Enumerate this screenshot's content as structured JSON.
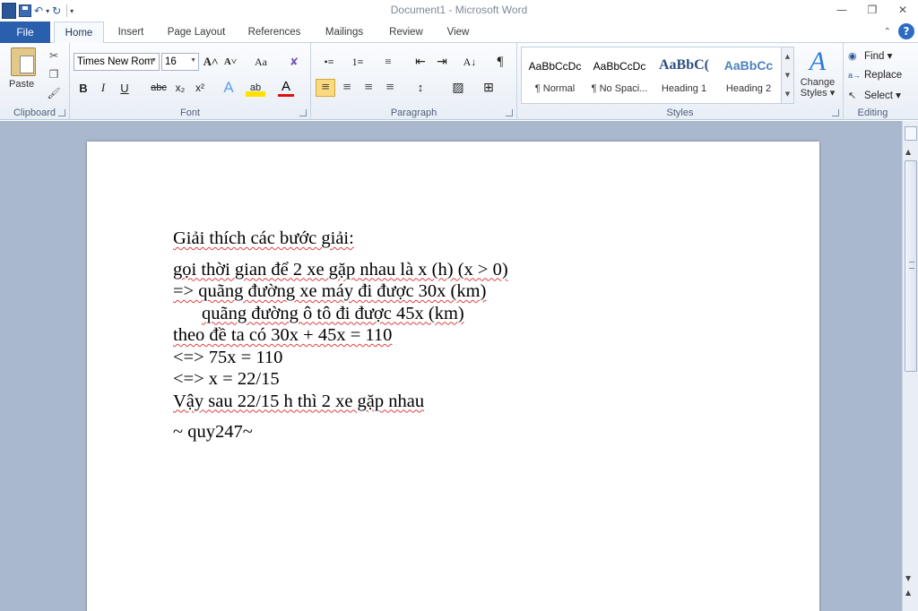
{
  "window": {
    "title": "Document1 - Microsoft Word",
    "minimize": "—",
    "restore": "❐",
    "close": "✕"
  },
  "qat": {
    "logo": "W",
    "undo": "↶",
    "redo": "↻",
    "customize": "▾"
  },
  "tabs": {
    "file": "File",
    "items": [
      "Home",
      "Insert",
      "Page Layout",
      "References",
      "Mailings",
      "Review",
      "View"
    ],
    "active": "Home"
  },
  "ribbon": {
    "clipboard": {
      "label": "Clipboard",
      "paste": "Paste"
    },
    "font": {
      "label": "Font",
      "font_name": "Times New Rom",
      "font_size": "16",
      "grow": "A˄",
      "shrink": "A˅",
      "change_case": "Aa",
      "clear": "✘",
      "bold": "B",
      "italic": "I",
      "underline": "U",
      "strike": "abc",
      "subscript": "x₂",
      "superscript": "x²",
      "effects": "A",
      "highlight": "ab",
      "font_color": "A"
    },
    "paragraph": {
      "label": "Paragraph",
      "bullets": "•≡",
      "numbering": "1≡",
      "multilevel": "≡",
      "decrease_indent": "⇤",
      "increase_indent": "⇥",
      "sort": "A↓",
      "show_marks": "¶",
      "align_left": "≡",
      "align_center": "≡",
      "align_right": "≡",
      "justify": "≡",
      "line_spacing": "↕",
      "shading": "▨",
      "borders": "⊞"
    },
    "styles": {
      "label": "Styles",
      "items": [
        {
          "sample": "AaBbCcDc",
          "name": "¶ Normal"
        },
        {
          "sample": "AaBbCcDc",
          "name": "¶ No Spaci..."
        },
        {
          "sample": "AaBbC(",
          "name": "Heading 1"
        },
        {
          "sample": "AaBbCc",
          "name": "Heading 2"
        }
      ],
      "change_styles_line1": "Change",
      "change_styles_line2": "Styles ▾"
    },
    "editing": {
      "label": "Editing",
      "find": "Find ▾",
      "replace": "Replace",
      "select": "Select ▾"
    }
  },
  "document": {
    "lines": [
      "Giải thích các bước giải:",
      "",
      "gọi thời gian để 2 xe gặp nhau là x (h) (x > 0)",
      "=> quãng đường xe máy đi được 30x (km)",
      "      quãng đường ô tô đi được 45x (km)",
      "theo đề ta có 30x + 45x = 110",
      "<=> 75x = 110",
      "<=> x = 22/15",
      "Vậy sau 22/15 h thì 2 xe gặp nhau",
      "",
      "~ quy247~"
    ]
  },
  "colors": {
    "file_tab": "#2a5fae",
    "doc_background": "#aab8ce",
    "spell_check": "#e04040"
  }
}
